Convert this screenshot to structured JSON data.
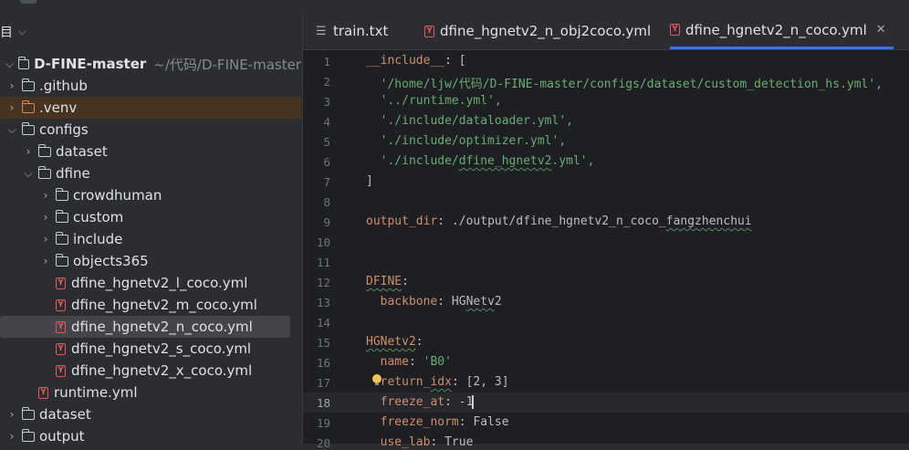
{
  "project_panel": {
    "header_label": "目",
    "tree": [
      {
        "label": "D-FINE-master",
        "path": "~/代码/D-FINE-master",
        "type": "folder",
        "expanded": true,
        "depth": 0
      },
      {
        "label": ".github",
        "type": "folder",
        "expanded": false,
        "depth": 1
      },
      {
        "label": ".venv",
        "type": "folder",
        "expanded": false,
        "depth": 1,
        "special": "venv"
      },
      {
        "label": "configs",
        "type": "folder",
        "expanded": true,
        "depth": 1
      },
      {
        "label": "dataset",
        "type": "folder",
        "expanded": false,
        "depth": 2
      },
      {
        "label": "dfine",
        "type": "folder",
        "expanded": true,
        "depth": 2
      },
      {
        "label": "crowdhuman",
        "type": "folder",
        "expanded": false,
        "depth": 3
      },
      {
        "label": "custom",
        "type": "folder",
        "expanded": false,
        "depth": 3
      },
      {
        "label": "include",
        "type": "folder",
        "expanded": false,
        "depth": 3
      },
      {
        "label": "objects365",
        "type": "folder",
        "expanded": false,
        "depth": 3
      },
      {
        "label": "dfine_hgnetv2_l_coco.yml",
        "type": "yaml",
        "depth": 3
      },
      {
        "label": "dfine_hgnetv2_m_coco.yml",
        "type": "yaml",
        "depth": 3
      },
      {
        "label": "dfine_hgnetv2_n_coco.yml",
        "type": "yaml",
        "depth": 3,
        "selected": true
      },
      {
        "label": "dfine_hgnetv2_s_coco.yml",
        "type": "yaml",
        "depth": 3
      },
      {
        "label": "dfine_hgnetv2_x_coco.yml",
        "type": "yaml",
        "depth": 3
      },
      {
        "label": "runtime.yml",
        "type": "yaml",
        "depth": 2
      },
      {
        "label": "dataset",
        "type": "folder",
        "expanded": false,
        "depth": 1
      },
      {
        "label": "output",
        "type": "folder",
        "expanded": false,
        "depth": 1
      }
    ]
  },
  "tabs": [
    {
      "label": "train.txt",
      "icon": "text-file-icon",
      "active": false
    },
    {
      "label": "dfine_hgnetv2_n_obj2coco.yml",
      "icon": "yaml-file-icon",
      "active": false
    },
    {
      "label": "dfine_hgnetv2_n_coco.yml",
      "icon": "yaml-file-icon",
      "active": true,
      "closable": true
    }
  ],
  "editor": {
    "current_line": 18,
    "lines": [
      {
        "n": "1",
        "text": "__include__: ["
      },
      {
        "n": "2",
        "text": "  '/home/ljw/代码/D-FINE-master/configs/dataset/custom_detection_hs.yml',"
      },
      {
        "n": "3",
        "text": "  '../runtime.yml',"
      },
      {
        "n": "4",
        "text": "  './include/dataloader.yml',"
      },
      {
        "n": "5",
        "text": "  './include/optimizer.yml',"
      },
      {
        "n": "6",
        "text": "  './include/dfine_hgnetv2.yml',"
      },
      {
        "n": "7",
        "text": "]"
      },
      {
        "n": "8",
        "text": ""
      },
      {
        "n": "9",
        "text": "output_dir: ./output/dfine_hgnetv2_n_coco_fangzhenchui"
      },
      {
        "n": "10",
        "text": ""
      },
      {
        "n": "11",
        "text": ""
      },
      {
        "n": "12",
        "text": "DFINE:"
      },
      {
        "n": "13",
        "text": "  backbone: HGNetv2"
      },
      {
        "n": "14",
        "text": ""
      },
      {
        "n": "15",
        "text": "HGNetv2:"
      },
      {
        "n": "16",
        "text": "  name: 'B0'"
      },
      {
        "n": "17",
        "text": "  return_idx: [2, 3]"
      },
      {
        "n": "18",
        "text": "  freeze_at: -1"
      },
      {
        "n": "19",
        "text": "  freeze_norm: False"
      },
      {
        "n": "20",
        "text": "  use_lab: True"
      }
    ]
  },
  "colors": {
    "key": "#cf8e6d",
    "string": "#6aab73",
    "text": "#bcbec4",
    "accent": "#3574f0"
  }
}
